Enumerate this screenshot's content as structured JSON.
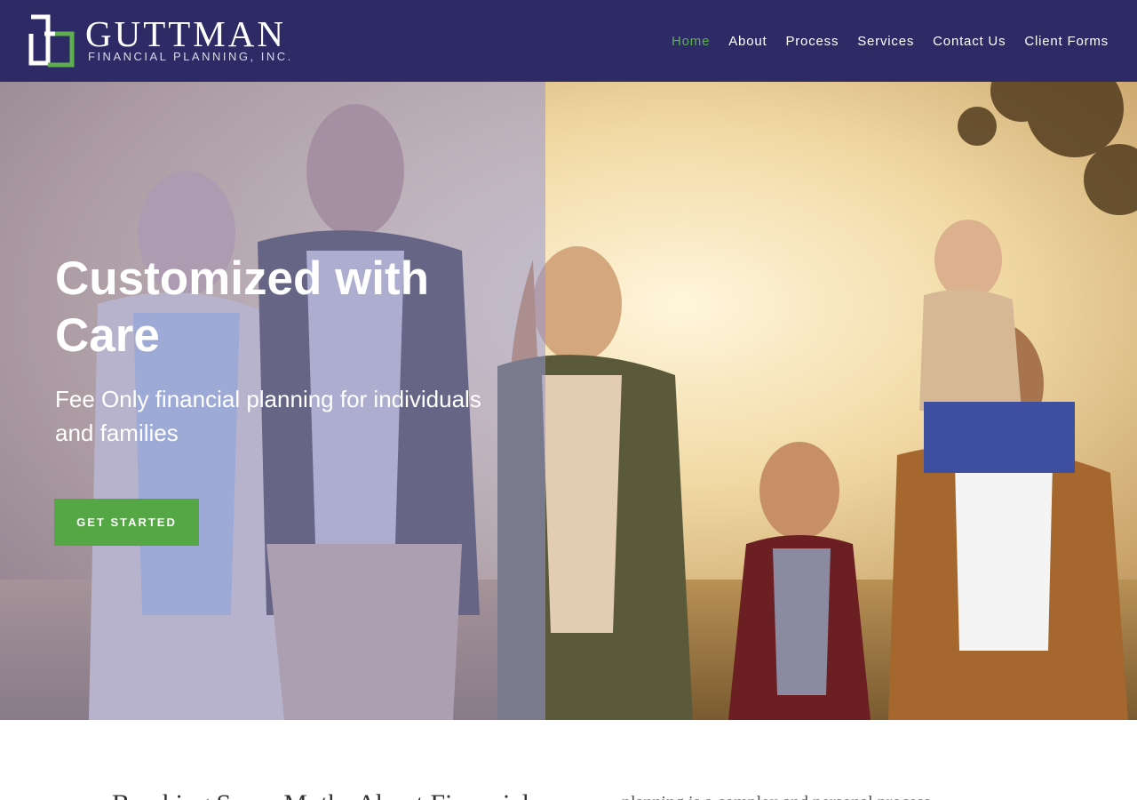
{
  "header": {
    "logo": {
      "name": "GUTTMAN",
      "subtitle": "FINANCIAL PLANNING, INC.",
      "mark_icon": "guttman-g-logo-icon"
    },
    "nav": [
      {
        "label": "Home",
        "active": true
      },
      {
        "label": "About"
      },
      {
        "label": "Process"
      },
      {
        "label": "Services"
      },
      {
        "label": "Contact Us"
      },
      {
        "label": "Client Forms"
      }
    ]
  },
  "hero": {
    "title": "Customized with Care",
    "subtitle": "Fee Only financial planning for individuals and families",
    "cta_label": "GET STARTED"
  },
  "intro": {
    "heading": "Breaking Some Myths About Financial",
    "body": "planning is a complex and personal process..."
  },
  "colors": {
    "header_bg": "#2d2a66",
    "nav_active": "#5fae4f",
    "cta_bg": "#55a645",
    "hero_overlay": "#9696d2"
  }
}
